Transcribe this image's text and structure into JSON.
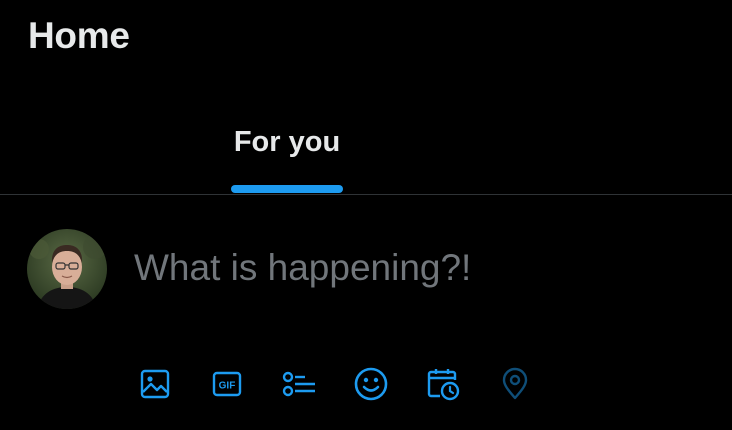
{
  "header": {
    "title": "Home"
  },
  "tabs": [
    {
      "label": "For you",
      "selected": true
    }
  ],
  "composer": {
    "placeholder": "What is happening?!",
    "value": "",
    "avatar": "user-avatar-photo"
  },
  "toolbar": {
    "icons": [
      "media-icon",
      "gif-icon",
      "poll-icon",
      "emoji-icon",
      "schedule-icon",
      "location-icon"
    ],
    "gif_text": "GIF"
  },
  "colors": {
    "background": "#000000",
    "text": "#e7e9ea",
    "placeholder": "#71767b",
    "accent": "#1d9bf0",
    "divider": "#2f3336"
  }
}
